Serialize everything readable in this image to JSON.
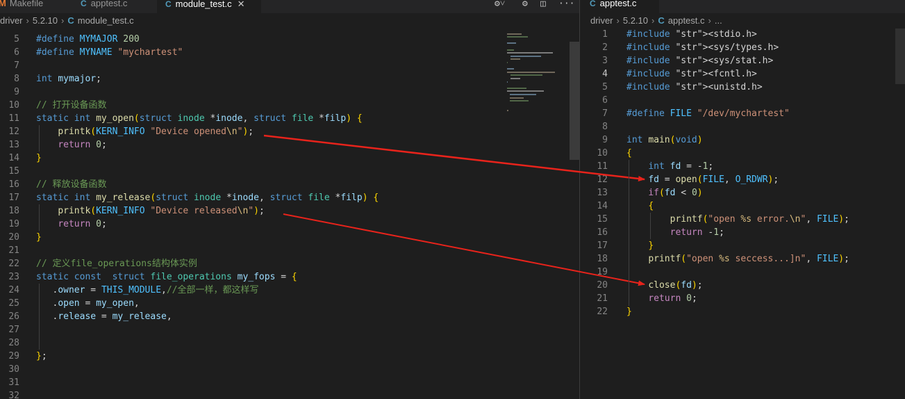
{
  "left_tabs": [
    {
      "label": "Makefile",
      "icon": "makefile-icon"
    },
    {
      "label": "apptest.c",
      "icon": "c-file-icon"
    },
    {
      "label": "module_test.c",
      "icon": "c-file-icon",
      "active": true
    }
  ],
  "right_tabs": [
    {
      "label": "apptest.c",
      "icon": "c-file-icon",
      "active": true
    }
  ],
  "left_breadcrumb": {
    "parts": [
      "driver",
      "5.2.10",
      "module_test.c"
    ]
  },
  "right_breadcrumb": {
    "parts": [
      "driver",
      "5.2.10",
      "apptest.c",
      "..."
    ]
  },
  "left_editor": {
    "first_line": 4,
    "lines": [
      "",
      "#define MYMAJOR 200",
      "#define MYNAME \"mychartest\"",
      "",
      "int mymajor;",
      "",
      "// 打开设备函数",
      "static int my_open(struct inode *inode, struct file *filp) {",
      "    printk(KERN_INFO \"Device opened\\n\");",
      "    return 0;",
      "}",
      "",
      "// 释放设备函数",
      "static int my_release(struct inode *inode, struct file *filp) {",
      "    printk(KERN_INFO \"Device released\\n\");",
      "    return 0;",
      "}",
      "",
      "// 定义file_operations结构体实例",
      "static const  struct file_operations my_fops = {",
      "   .owner = THIS_MODULE,//全部一样，都这样写",
      "   .open = my_open,",
      "   .release = my_release,",
      "",
      "",
      "};",
      "",
      "",
      ""
    ]
  },
  "right_editor": {
    "first_line": 1,
    "current_line": 4,
    "lines": [
      "#include <stdio.h>",
      "#include <sys/types.h>",
      "#include <sys/stat.h>",
      "#include <fcntl.h>",
      "#include <unistd.h>",
      "",
      "#define FILE \"/dev/mychartest\"",
      "",
      "int main(void)",
      "{",
      "    int fd = -1;",
      "    fd = open(FILE, O_RDWR);",
      "    if(fd < 0)",
      "    {",
      "        printf(\"open %s error.\\n\", FILE);",
      "        return -1;",
      "    }",
      "    printf(\"open %s seccess...]n\", FILE);",
      "",
      "    close(fd);",
      "    return 0;",
      "}"
    ]
  },
  "annotation_arrows": [
    {
      "from": "module_test.c line 12 (printk Device opened)",
      "to": "apptest.c line 12 (open)"
    },
    {
      "from": "module_test.c line 18 (printk Device released)",
      "to": "apptest.c line 20 (close)"
    }
  ],
  "colors": {
    "arrow": "#e8231b",
    "background": "#1e1e1e",
    "accent": "#0078d4"
  },
  "toolbar_icons": [
    "settings-sync-icon",
    "gear-icon",
    "split-editor-icon",
    "more-actions-icon"
  ]
}
